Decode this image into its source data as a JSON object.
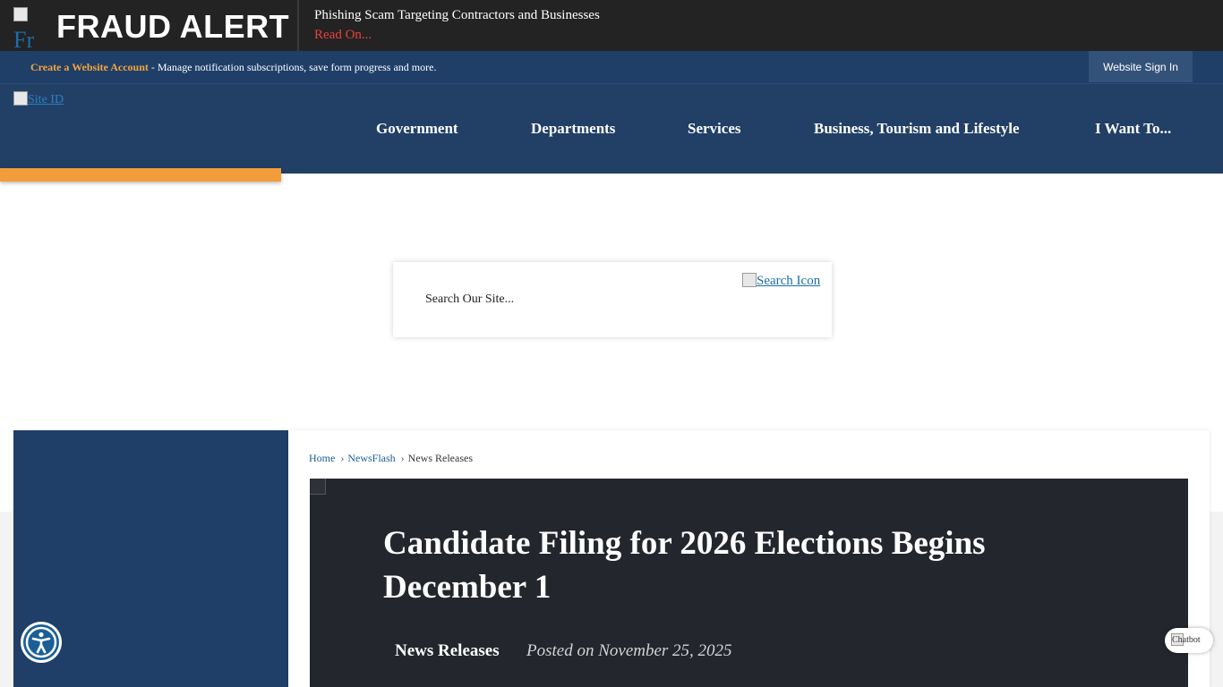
{
  "alert": {
    "image_alt": "Fr",
    "title": "FRAUD ALERT",
    "message": "Phishing Scam Targeting Contractors and Businesses",
    "link": "Read On..."
  },
  "account_bar": {
    "create_link": "Create a Website Account",
    "description": " - Manage notification subscriptions, save form progress and more.",
    "sign_in": "Website Sign In"
  },
  "header": {
    "logo_alt": "Site ID",
    "nav": [
      "Government",
      "Departments",
      "Services",
      "Business, Tourism and Lifestyle",
      "I Want To..."
    ]
  },
  "search": {
    "placeholder": "Search Our Site...",
    "icon_alt": "Search Icon"
  },
  "breadcrumb": {
    "home": "Home",
    "newsflash": "NewsFlash",
    "current": "News Releases",
    "separator": "›"
  },
  "article": {
    "title": "Candidate Filing for 2026 Elections Begins December 1",
    "category": "News Releases",
    "posted": "Posted on November 25, 2025"
  },
  "widgets": {
    "chat_alt": "Chatbot",
    "accessibility_icon": "accessibility-icon"
  },
  "colors": {
    "alert_bg": "#232323",
    "alert_link": "#e8433a",
    "account_bar": "#1f3f69",
    "header": "#223f66",
    "accent_orange": "#f39c3a",
    "hero_bg": "#23262d",
    "link_blue": "#1b5f96"
  }
}
